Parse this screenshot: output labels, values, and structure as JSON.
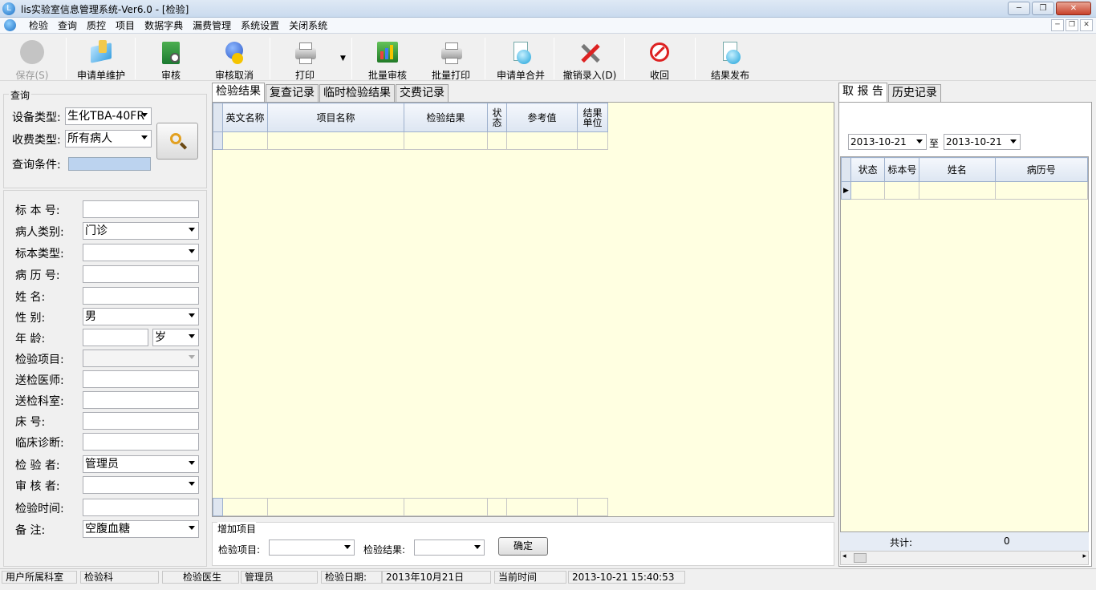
{
  "window": {
    "title": "lis实验室信息管理系统-Ver6.0    - [检验]"
  },
  "menu": [
    "检验",
    "查询",
    "质控",
    "项目",
    "数据字典",
    "漏费管理",
    "系统设置",
    "关闭系统"
  ],
  "toolbar": {
    "save": "保存(S)",
    "request_maint": "申请单维护",
    "review": "审核",
    "review_cancel": "审核取消",
    "print": "打印",
    "batch_review": "批量审核",
    "batch_print": "批量打印",
    "merge_request": "申请单合并",
    "undo_entry": "撤销录入(D)",
    "recall": "收回",
    "publish": "结果发布"
  },
  "query": {
    "group_title": "查询",
    "device_label": "设备类型:",
    "device_value": "生化TBA-40FR",
    "fee_label": "收费类型:",
    "fee_value": "所有病人",
    "condition_label": "查询条件:"
  },
  "form": {
    "specimen_no": "标 本 号:",
    "patient_type": "病人类别:",
    "patient_type_value": "门诊",
    "specimen_type": "标本类型:",
    "record_no": "病 历 号:",
    "name": "姓    名:",
    "gender": "性    别:",
    "gender_value": "男",
    "age": "年    龄:",
    "age_unit": "岁",
    "test_item": "检验项目:",
    "doctor": "送检医师:",
    "dept": "送检科室:",
    "bed": "床    号:",
    "diagnosis": "临床诊断:",
    "tester": "检 验 者:",
    "tester_value": "管理员",
    "reviewer": "审 核 者:",
    "test_time": "检验时间:",
    "remark": "备    注:",
    "remark_value": "空腹血糖"
  },
  "center": {
    "tabs": [
      "检验结果",
      "复查记录",
      "临时检验结果",
      "交费记录"
    ],
    "columns": [
      "英文名称",
      "项目名称",
      "检验结果",
      "状态",
      "参考值",
      "结果单位"
    ],
    "add_title": "增加项目",
    "add_item_label": "检验项目:",
    "add_result_label": "检验结果:",
    "confirm": "确定"
  },
  "right": {
    "tabs": [
      "取 报 告",
      "历史记录"
    ],
    "date_from": "2013-10-21",
    "date_sep": "至",
    "date_to": "2013-10-21",
    "columns": [
      "状态",
      "标本号",
      "姓名",
      "病历号"
    ],
    "total_label": "共计:",
    "total_value": "0"
  },
  "status": {
    "user_dept_label": "用户所属科室",
    "user_dept": "检验科",
    "doctor_label": "检验医生",
    "doctor": "管理员",
    "date_label": "检验日期:",
    "date": "2013年10月21日",
    "now_label": "当前时间",
    "now": "2013-10-21 15:40:53"
  }
}
